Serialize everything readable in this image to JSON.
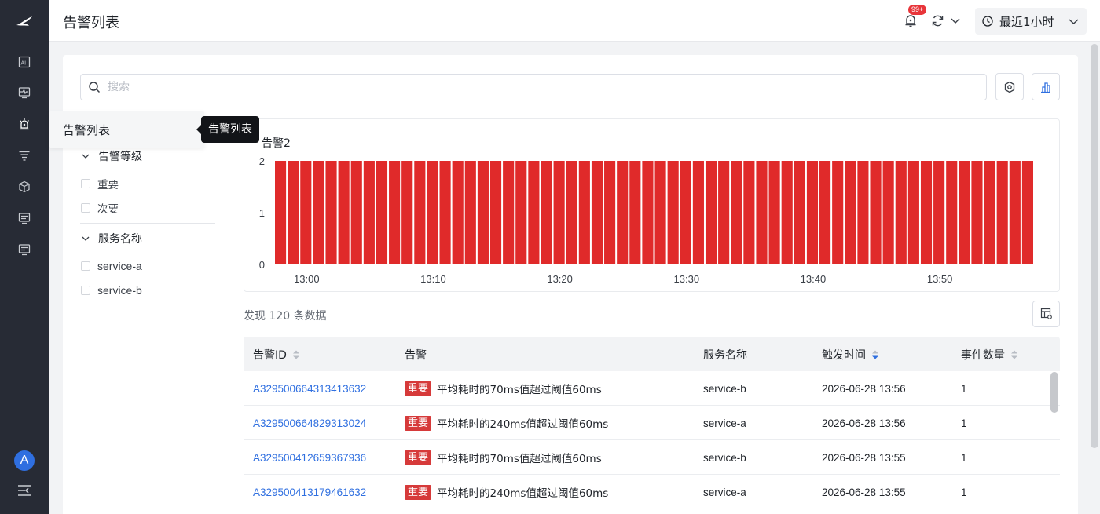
{
  "header": {
    "title": "告警列表",
    "notify_badge": "99+",
    "time_range": "最近1小时"
  },
  "nav": {
    "avatar_letter": "A",
    "flyout_label": "告警列表",
    "tooltip": "告警列表"
  },
  "search": {
    "placeholder": "搜索"
  },
  "filters": {
    "groups": [
      {
        "label": "告警等级",
        "options": [
          "重要",
          "次要"
        ]
      },
      {
        "label": "服务名称",
        "options": [
          "service-a",
          "service-b"
        ]
      }
    ]
  },
  "chart_data": {
    "type": "bar",
    "title": "告警2",
    "ylim": [
      0,
      2
    ],
    "yticks": [
      "2",
      "1",
      "0"
    ],
    "xticks": [
      "13:00",
      "13:10",
      "13:20",
      "13:30",
      "13:40",
      "13:50"
    ],
    "bar_count": 60,
    "values": [
      2,
      2,
      2,
      2,
      2,
      2,
      2,
      2,
      2,
      2,
      2,
      2,
      2,
      2,
      2,
      2,
      2,
      2,
      2,
      2,
      2,
      2,
      2,
      2,
      2,
      2,
      2,
      2,
      2,
      2,
      2,
      2,
      2,
      2,
      2,
      2,
      2,
      2,
      2,
      2,
      2,
      2,
      2,
      2,
      2,
      2,
      2,
      2,
      2,
      2,
      2,
      2,
      2,
      2,
      2,
      2,
      2,
      2,
      2,
      2
    ],
    "color": "#e02a2a"
  },
  "results": {
    "count_text": "发现 120 条数据"
  },
  "table": {
    "headers": [
      "告警ID",
      "告警",
      "服务名称",
      "触发时间",
      "事件数量"
    ],
    "rows": [
      {
        "id": "A329500664313413632",
        "level": "重要",
        "message": "平均耗时的70ms值超过阈值60ms",
        "service": "service-b",
        "time": "2026-06-28 13:56",
        "count": "1"
      },
      {
        "id": "A329500664829313024",
        "level": "重要",
        "message": "平均耗时的240ms值超过阈值60ms",
        "service": "service-a",
        "time": "2026-06-28 13:56",
        "count": "1"
      },
      {
        "id": "A329500412659367936",
        "level": "重要",
        "message": "平均耗时的70ms值超过阈值60ms",
        "service": "service-b",
        "time": "2026-06-28 13:55",
        "count": "1"
      },
      {
        "id": "A329500413179461632",
        "level": "重要",
        "message": "平均耗时的240ms值超过阈值60ms",
        "service": "service-a",
        "time": "2026-06-28 13:55",
        "count": "1"
      }
    ]
  }
}
